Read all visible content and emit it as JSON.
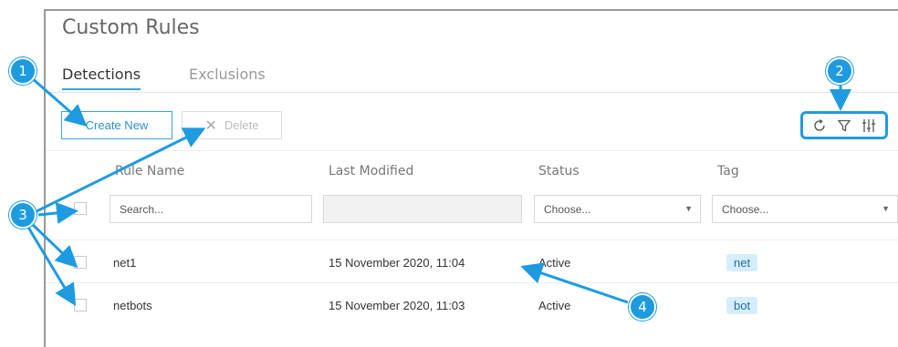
{
  "page": {
    "title": "Custom Rules"
  },
  "tabs": [
    {
      "label": "Detections",
      "active": true
    },
    {
      "label": "Exclusions",
      "active": false
    }
  ],
  "actions": {
    "create_label": "Create New",
    "delete_label": "Delete"
  },
  "toolbar": {
    "icons": [
      "refresh-icon",
      "filter-icon",
      "column-settings-icon"
    ]
  },
  "table": {
    "columns": [
      "Rule Name",
      "Last Modified",
      "Status",
      "Tag"
    ],
    "filters": {
      "search_placeholder": "Search...",
      "status_placeholder": "Choose...",
      "tag_placeholder": "Choose..."
    },
    "rows": [
      {
        "name": "net1",
        "modified": "15 November 2020, 11:04",
        "status": "Active",
        "tag": "net"
      },
      {
        "name": "netbots",
        "modified": "15 November 2020, 11:03",
        "status": "Active",
        "tag": "bot"
      }
    ]
  },
  "callouts": [
    "1",
    "2",
    "3",
    "4"
  ],
  "colors": {
    "accent": "#1e9be0",
    "tag_bg": "#d6eefc",
    "border": "#999999"
  }
}
